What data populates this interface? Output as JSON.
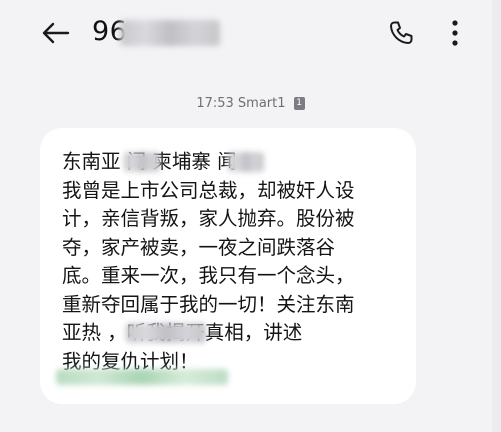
{
  "header": {
    "contact_visible": "96",
    "back_icon": "arrow-left-icon",
    "call_icon": "phone-icon",
    "menu_icon": "more-vertical-icon"
  },
  "message_meta": {
    "time": "17:53",
    "carrier": "Smart1",
    "sim": "1"
  },
  "message": {
    "lines": [
      "东南亚 闻 柬埔寨 闻",
      "我曾是上市公司总裁，却被奸人设",
      "计，亲信背叛，家人抛弃。股份被",
      "夺，家产被卖，一夜之间跌落谷",
      "底。重来一次，我只有一个念头，",
      "重新夺回属于我的一切！关注东南",
      "亚热 ，听我揭开真相，讲述",
      "我的复仇计划！"
    ]
  },
  "colors": {
    "background": "#f3f3f5",
    "bubble": "#ffffff",
    "text": "#141414",
    "meta": "#6f6f74"
  }
}
